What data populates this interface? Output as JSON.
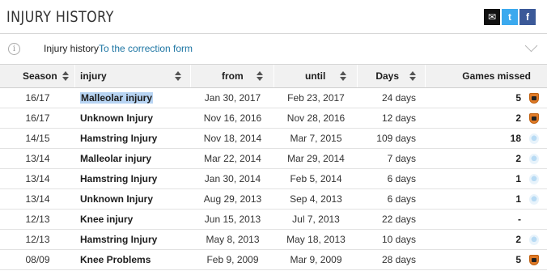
{
  "header": {
    "title": "INJURY HISTORY",
    "share": {
      "mail_icon": "envelope-icon",
      "twitter_icon": "twitter-icon",
      "twitter_glyph": "t",
      "facebook_icon": "facebook-icon",
      "facebook_glyph": "f"
    }
  },
  "infobar": {
    "label": "Injury history",
    "link": "To the correction form"
  },
  "table": {
    "columns": [
      "Season",
      "injury",
      "from",
      "until",
      "Days",
      "Games missed"
    ],
    "rows": [
      {
        "season": "16/17",
        "injury": "Malleolar injury",
        "from": "Jan 30, 2017",
        "until": "Feb 23, 2017",
        "days": "24 days",
        "games": "5",
        "club": "lorient"
      },
      {
        "season": "16/17",
        "injury": "Unknown Injury",
        "from": "Nov 16, 2016",
        "until": "Nov 28, 2016",
        "days": "12 days",
        "games": "2",
        "club": "lorient"
      },
      {
        "season": "14/15",
        "injury": "Hamstring Injury",
        "from": "Nov 18, 2014",
        "until": "Mar 7, 2015",
        "days": "109 days",
        "games": "18",
        "club": "lazio"
      },
      {
        "season": "13/14",
        "injury": "Malleolar injury",
        "from": "Mar 22, 2014",
        "until": "Mar 29, 2014",
        "days": "7 days",
        "games": "2",
        "club": "lazio"
      },
      {
        "season": "13/14",
        "injury": "Hamstring Injury",
        "from": "Jan 30, 2014",
        "until": "Feb 5, 2014",
        "days": "6 days",
        "games": "1",
        "club": "lazio"
      },
      {
        "season": "13/14",
        "injury": "Unknown Injury",
        "from": "Aug 29, 2013",
        "until": "Sep 4, 2013",
        "days": "6 days",
        "games": "1",
        "club": "lazio"
      },
      {
        "season": "12/13",
        "injury": "Knee injury",
        "from": "Jun 15, 2013",
        "until": "Jul 7, 2013",
        "days": "22 days",
        "games": "-",
        "club": ""
      },
      {
        "season": "12/13",
        "injury": "Hamstring Injury",
        "from": "May 8, 2013",
        "until": "May 18, 2013",
        "days": "10 days",
        "games": "2",
        "club": "lazio"
      },
      {
        "season": "08/09",
        "injury": "Knee Problems",
        "from": "Feb 9, 2009",
        "until": "Mar 9, 2009",
        "days": "28 days",
        "games": "5",
        "club": "lorient"
      }
    ]
  }
}
